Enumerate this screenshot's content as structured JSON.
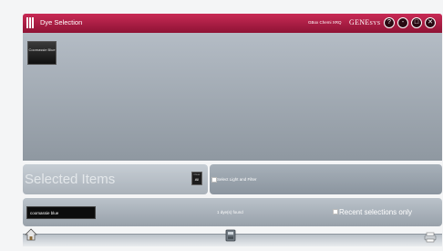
{
  "titlebar": {
    "title": "Dye Selection",
    "instrument": "GBox Chemi XRQ",
    "brand_main": "GENE",
    "brand_sub": "SYS",
    "buttons": [
      "?",
      "-",
      "□",
      "✕"
    ]
  },
  "dyes": [
    {
      "label": "Coomassie Blue"
    }
  ],
  "selected": {
    "title": "Selected Items",
    "clear_top": "Clear",
    "clear_bottom": "All"
  },
  "light": {
    "label": "Select Light and Filter"
  },
  "search": {
    "value": "coomassie blue",
    "found_text": "1 dye(s) found",
    "recent_label": "Recent selections only"
  },
  "icons": {
    "home": "home-icon",
    "machine": "machine-icon",
    "printer": "printer-icon"
  }
}
